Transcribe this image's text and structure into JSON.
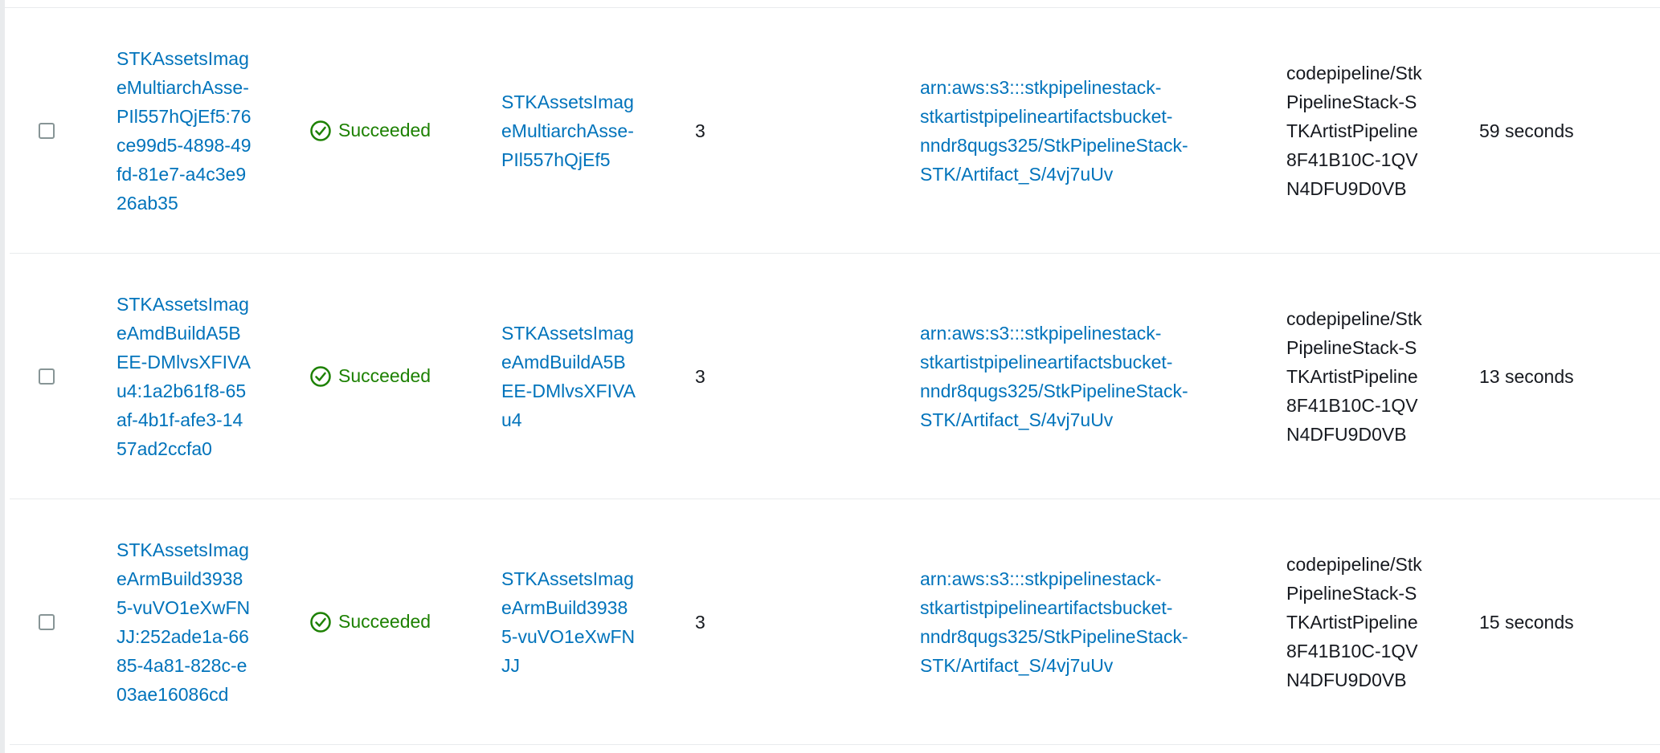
{
  "rows": [
    {
      "name": "STKAssetsImageMultiarchAsse-PIl557hQjEf5:76ce99d5-4898-49fd-81e7-a4c3e926ab35",
      "status": "Succeeded",
      "action": "STKAssetsImageMultiarchAsse-PIl557hQjEf5",
      "version": "3",
      "artifact": "arn:aws:s3:::stkpipelinestack-stkartistpipelineartifactsbucket-nndr8qugs325/StkPipelineStack-STK/Artifact_S/4vj7uUv",
      "role": "codepipeline/StkPipelineStack-STKArtistPipeline8F41B10C-1QVN4DFU9D0VB",
      "duration": "59 seconds"
    },
    {
      "name": "STKAssetsImageAmdBuildA5BEE-DMlvsXFIVAu4:1a2b61f8-65af-4b1f-afe3-1457ad2ccfa0",
      "status": "Succeeded",
      "action": "STKAssetsImageAmdBuildA5BEE-DMlvsXFIVAu4",
      "version": "3",
      "artifact": "arn:aws:s3:::stkpipelinestack-stkartistpipelineartifactsbucket-nndr8qugs325/StkPipelineStack-STK/Artifact_S/4vj7uUv",
      "role": "codepipeline/StkPipelineStack-STKArtistPipeline8F41B10C-1QVN4DFU9D0VB",
      "duration": "13 seconds"
    },
    {
      "name": "STKAssetsImageArmBuild39385-vuVO1eXwFNJJ:252ade1a-6685-4a81-828c-e03ae16086cd",
      "status": "Succeeded",
      "action": "STKAssetsImageArmBuild39385-vuVO1eXwFNJJ",
      "version": "3",
      "artifact": "arn:aws:s3:::stkpipelinestack-stkartistpipelineartifactsbucket-nndr8qugs325/StkPipelineStack-STK/Artifact_S/4vj7uUv",
      "role": "codepipeline/StkPipelineStack-STKArtistPipeline8F41B10C-1QVN4DFU9D0VB",
      "duration": "15 seconds"
    }
  ],
  "icons": {
    "status": "success-check-circle-icon",
    "checkbox": "checkbox"
  },
  "colors": {
    "link": "#0073bb",
    "success": "#1d8102",
    "border": "#e9ebed",
    "checkbox_border": "#879596"
  }
}
